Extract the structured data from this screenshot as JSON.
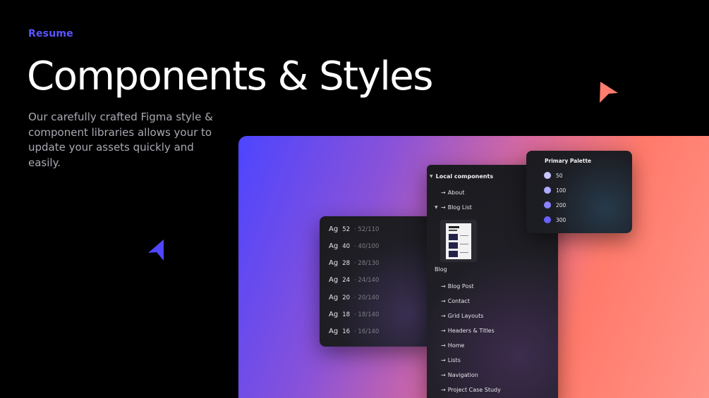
{
  "hero": {
    "eyebrow": "Resume",
    "title": "Components & Styles",
    "description": "Our carefully crafted Figma style & component libraries allows your to update your assets quickly and easily."
  },
  "colors": {
    "accent": "#5b55ff",
    "cursor_orange": "#ff7d6e",
    "cursor_blue": "#5046ff",
    "gradient": [
      "#4d45ff",
      "#8a52d8",
      "#d86a9e",
      "#ff7a6b",
      "#ff9488"
    ]
  },
  "type_scale": {
    "rows": [
      {
        "sample": "Ag",
        "size": "52",
        "meta": "· 52/110"
      },
      {
        "sample": "Ag",
        "size": "40",
        "meta": "· 40/100"
      },
      {
        "sample": "Ag",
        "size": "28",
        "meta": "· 28/130"
      },
      {
        "sample": "Ag",
        "size": "24",
        "meta": "· 24/140"
      },
      {
        "sample": "Ag",
        "size": "20",
        "meta": "· 20/140"
      },
      {
        "sample": "Ag",
        "size": "18",
        "meta": "· 18/140"
      },
      {
        "sample": "Ag",
        "size": "16",
        "meta": "· 16/140"
      }
    ]
  },
  "components": {
    "heading": "Local components",
    "caret_icon": "caret-down-icon",
    "items": [
      {
        "label": "About",
        "expanded": false
      },
      {
        "label": "Blog List",
        "expanded": true
      }
    ],
    "blog_label": "Blog",
    "more_items": [
      {
        "label": "Blog Post"
      },
      {
        "label": "Contact"
      },
      {
        "label": "Grid Layouts"
      },
      {
        "label": "Headers & Titles"
      },
      {
        "label": "Home"
      },
      {
        "label": "Lists"
      },
      {
        "label": "Navigation"
      },
      {
        "label": "Project Case Study"
      }
    ]
  },
  "palette": {
    "title": "Primary Palette",
    "swatches": [
      {
        "label": "50",
        "color": "#c9c7ff"
      },
      {
        "label": "100",
        "color": "#aeaaff"
      },
      {
        "label": "200",
        "color": "#8a84ff"
      },
      {
        "label": "300",
        "color": "#6a62ff"
      }
    ]
  }
}
